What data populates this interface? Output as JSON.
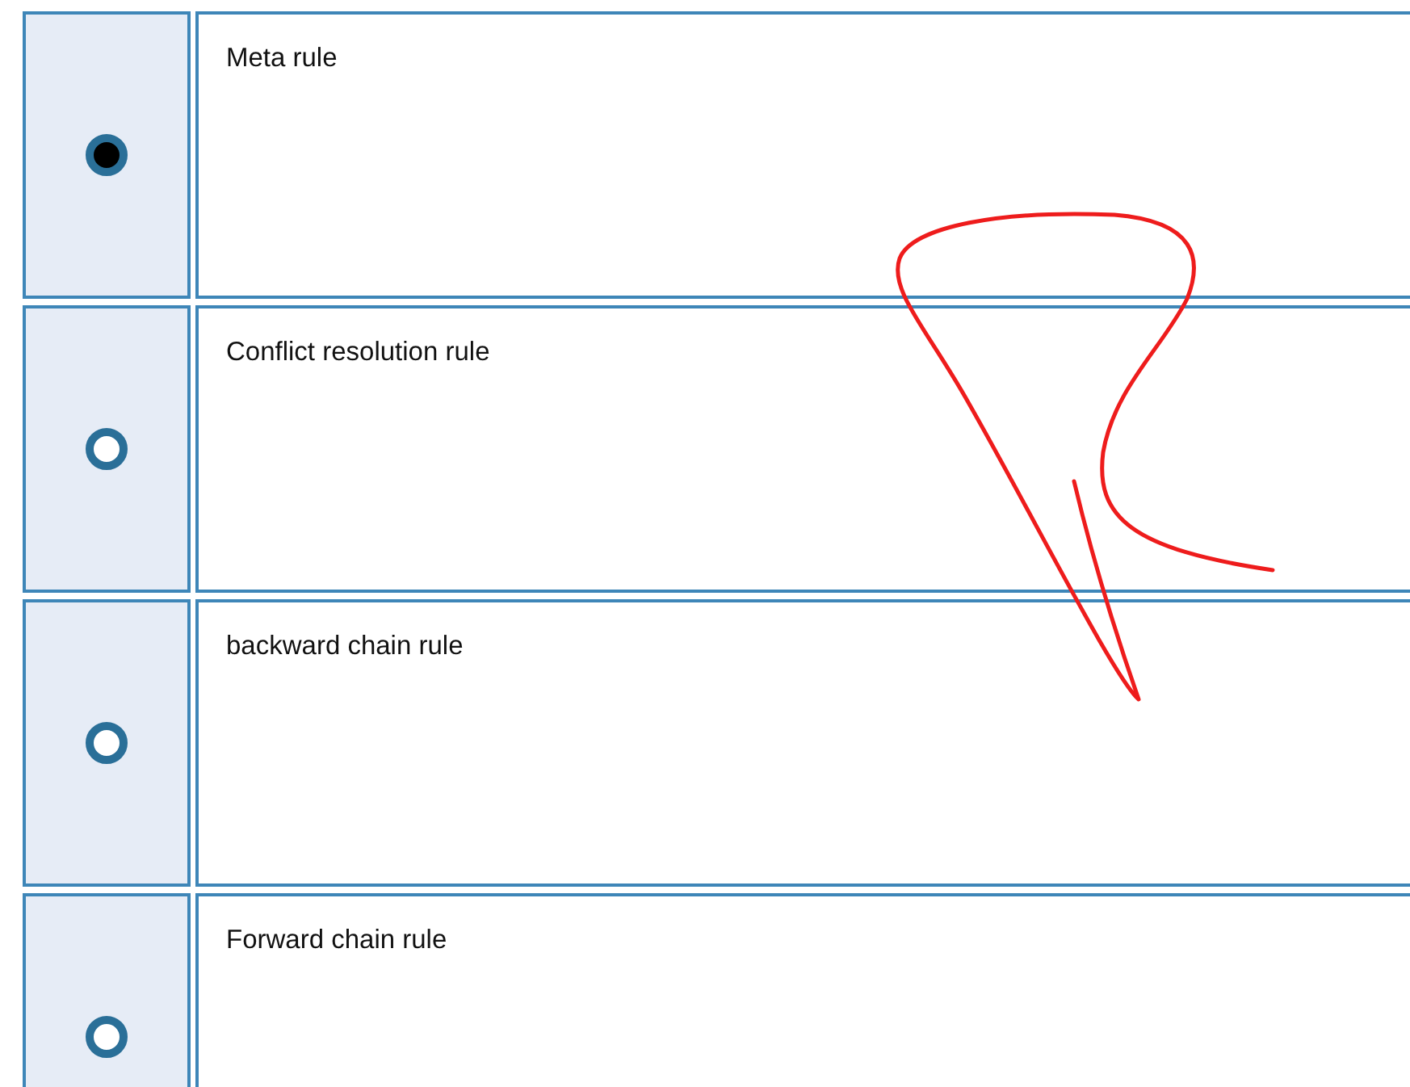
{
  "options": [
    {
      "label": "Meta rule",
      "selected": true
    },
    {
      "label": "Conflict resolution rule",
      "selected": false
    },
    {
      "label": "backward chain rule",
      "selected": false
    },
    {
      "label": "Forward chain rule",
      "selected": false
    }
  ]
}
